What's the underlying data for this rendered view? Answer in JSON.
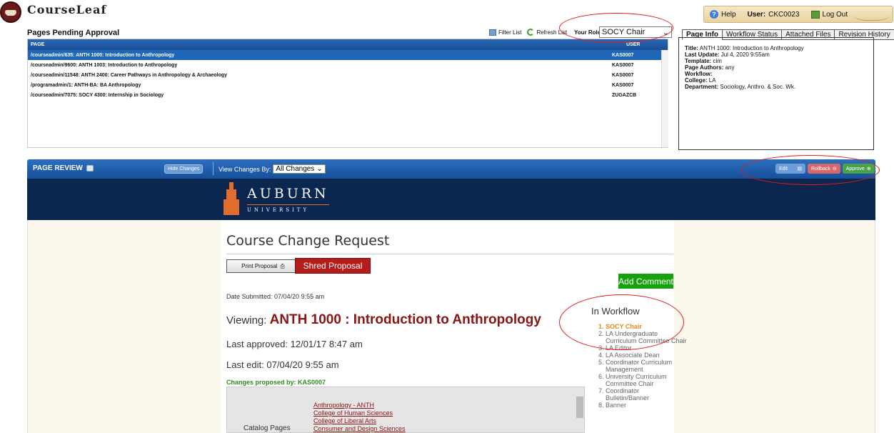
{
  "app": {
    "title": "CourseLeaf"
  },
  "topbar": {
    "help": "Help",
    "user_label": "User:",
    "user": "CKC0023",
    "logout": "Log Out"
  },
  "pending": {
    "title": "Pages Pending Approval",
    "filter_label": "Filter List",
    "refresh_label": "Refresh List",
    "role_label": "Your Role:",
    "role_value": "SOCY Chair",
    "col_page": "PAGE",
    "col_user": "USER",
    "rows": [
      {
        "page": "/courseadmin/635: ANTH 1000: Introduction to Anthropology",
        "user": "KAS0007"
      },
      {
        "page": "/courseadmin/9600: ANTH 1003: Introduction to Anthropology",
        "user": "KAS0007"
      },
      {
        "page": "/courseadmin/11548: ANTH 2400: Career Pathways in Anthropology & Archaeology",
        "user": "KAS0007"
      },
      {
        "page": "/programadmin/1: ANTH-BA: BA Anthropology",
        "user": "KAS0007"
      },
      {
        "page": "/courseadmin/7075: SOCY 4300: Internship in Sociology",
        "user": "ZUGAZCB"
      }
    ]
  },
  "tabs": [
    "Page Info",
    "Workflow Status",
    "Attached Files",
    "Revision History"
  ],
  "info": {
    "title_k": "Title:",
    "title_v": "ANTH 1000: Introduction to Anthropology",
    "update_k": "Last Update:",
    "update_v": "Jul 4, 2020 9:55am",
    "template_k": "Template:",
    "template_v": "cim",
    "authors_k": "Page Authors:",
    "authors_v": "any",
    "workflow_k": "Workflow:",
    "workflow_v": "",
    "college_k": "College:",
    "college_v": "LA",
    "dept_k": "Department:",
    "dept_v": "Sociology, Anthro. & Soc. Wk."
  },
  "review": {
    "title": "PAGE REVIEW",
    "hide_changes": "Hide Changes",
    "view_by_label": "View Changes By:",
    "view_by_value": "All Changes",
    "edit": "Edit",
    "rollback": "Rollback",
    "approve": "Approve"
  },
  "banner": {
    "name": "AUBURN",
    "sub": "UNIVERSITY"
  },
  "proposal": {
    "heading": "Course Change Request",
    "print": "Print Proposal",
    "shred": "Shred Proposal",
    "add_comment": "Add Comment",
    "date_submitted": "Date Submitted: 07/04/20 9:55 am",
    "viewing_label": "Viewing:",
    "viewing_title": "ANTH 1000 : Introduction to Anthropology",
    "last_approved": "Last approved: 12/01/17 8:47 am",
    "last_edit": "Last edit: 07/04/20 9:55 am",
    "changes_by": "Changes proposed by: KAS0007",
    "catalog_label": "Catalog Pages",
    "catalog_links": [
      "Anthropology - ANTH",
      "College of Human Sciences",
      "College of Liberal Arts",
      "Consumer and Design Sciences"
    ]
  },
  "workflow": {
    "title": "In Workflow",
    "steps": [
      {
        "n": "1.",
        "label": "SOCY Chair",
        "cont": ""
      },
      {
        "n": "2.",
        "label": "LA Undergraduate",
        "cont": "Curriculum Committee Chair"
      },
      {
        "n": "3.",
        "label": "LA Editor",
        "cont": ""
      },
      {
        "n": "4.",
        "label": "LA Associate Dean",
        "cont": ""
      },
      {
        "n": "5.",
        "label": "Coordinator Curriculum",
        "cont": "Management"
      },
      {
        "n": "6.",
        "label": "University Curriculum",
        "cont": "Committee Chair"
      },
      {
        "n": "7.",
        "label": "Coordinator",
        "cont": "Bulletin/Banner"
      },
      {
        "n": "8.",
        "label": "Banner",
        "cont": ""
      }
    ]
  }
}
